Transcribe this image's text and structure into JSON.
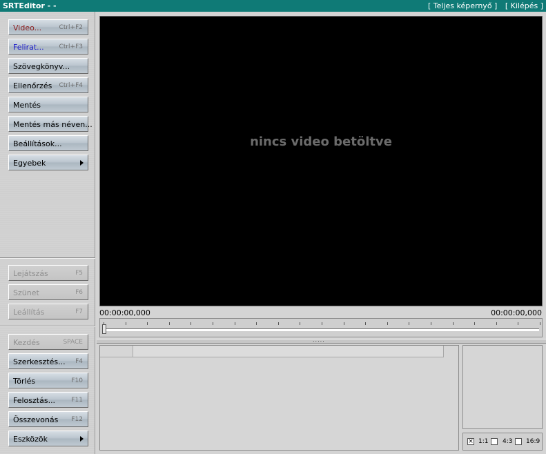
{
  "titlebar": {
    "title": "SRTEditor -  -",
    "fullscreen": "[ Teljes képernyő ]",
    "exit": "[ Kilépés ]"
  },
  "sidebar": {
    "top": [
      {
        "label": "Video...",
        "shortcut": "Ctrl+F2",
        "color": "#8b1a1a"
      },
      {
        "label": "Felirat...",
        "shortcut": "Ctrl+F3",
        "color": "#1a1acb"
      },
      {
        "label": "Szövegkönyv...",
        "shortcut": ""
      },
      {
        "label": "Ellenőrzés",
        "shortcut": "Ctrl+F4"
      },
      {
        "label": "Mentés",
        "shortcut": ""
      },
      {
        "label": "Mentés más néven...",
        "shortcut": ""
      },
      {
        "label": "Beállítások...",
        "shortcut": ""
      },
      {
        "label": "Egyebek",
        "shortcut": "",
        "submenu": true
      }
    ],
    "playback": [
      {
        "label": "Lejátszás",
        "shortcut": "F5",
        "disabled": true
      },
      {
        "label": "Szünet",
        "shortcut": "F6",
        "disabled": true
      },
      {
        "label": "Leállítás",
        "shortcut": "F7",
        "disabled": true
      }
    ],
    "edit": [
      {
        "label": "Kezdés",
        "shortcut": "SPACE",
        "disabled": true
      },
      {
        "label": "Szerkesztés...",
        "shortcut": "F4"
      },
      {
        "label": "Törlés",
        "shortcut": "F10"
      },
      {
        "label": "Felosztás...",
        "shortcut": "F11"
      },
      {
        "label": "Összevonás",
        "shortcut": "F12"
      },
      {
        "label": "Eszközök",
        "shortcut": "",
        "submenu": true
      }
    ]
  },
  "video": {
    "message": "nincs video betöltve",
    "time_start": "00:00:00,000",
    "time_end": "00:00:00,000",
    "position": 0
  },
  "splitter": {
    "grip": "....."
  },
  "aspect": {
    "options": [
      {
        "label": "1:1",
        "checked": true
      },
      {
        "label": "4:3",
        "checked": false
      },
      {
        "label": "16:9",
        "checked": false
      }
    ]
  }
}
